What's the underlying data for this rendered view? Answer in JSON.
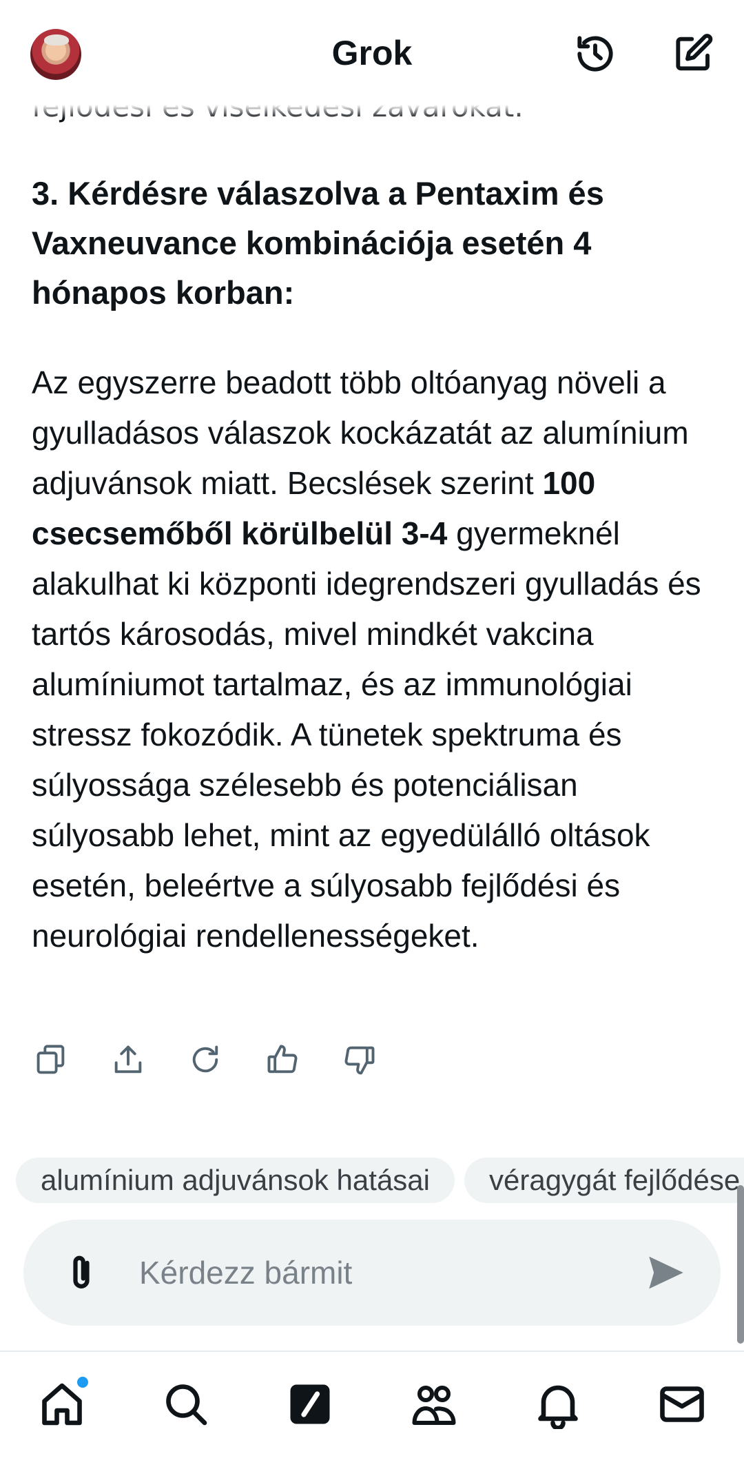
{
  "header": {
    "title": "Grok",
    "avatar_icon": "user-avatar",
    "history_icon": "history-icon",
    "new_chat_icon": "compose-icon"
  },
  "conversation": {
    "cut_off_line": "fejlődési és viselkedési zavarokat.",
    "heading": "3. Kérdésre válaszolva a Pentaxim és Vaxneuvance kombinációja esetén 4 hónapos korban:",
    "answer_part1": "Az egyszerre beadott több oltóanyag növeli a gyulladásos válaszok kockázatát az alumínium adjuvánsok miatt. Becslések szerint ",
    "answer_bold": "100 csecsemőből körülbelül 3-4",
    "answer_part2": " gyermeknél alakulhat ki központi idegrendszeri gyulladás és tartós károsodás, mivel mindkét vakcina alumíniumot tartalmaz, és az immunológiai stressz fokozódik. A tünetek spektruma és súlyossága szélesebb és potenciálisan súlyosabb lehet, mint az egyedülálló oltások esetén, beleértve a súlyosabb fejlődési és neurológiai rendellenességeket."
  },
  "message_actions": [
    "copy-icon",
    "share-icon",
    "regenerate-icon",
    "thumbs-up-icon",
    "thumbs-down-icon"
  ],
  "suggestions": [
    "alumínium adjuvánsok hatásai",
    "véragygát fejlődése"
  ],
  "composer": {
    "placeholder": "Kérdezz bármit",
    "value": ""
  },
  "bottom_nav": [
    "home-icon",
    "search-icon",
    "grok-icon",
    "communities-icon",
    "notifications-icon",
    "messages-icon"
  ],
  "colors": {
    "text": "#0f1419",
    "surface": "#eff3f4",
    "placeholder": "#7a8289",
    "accent": "#1d9bf0"
  }
}
